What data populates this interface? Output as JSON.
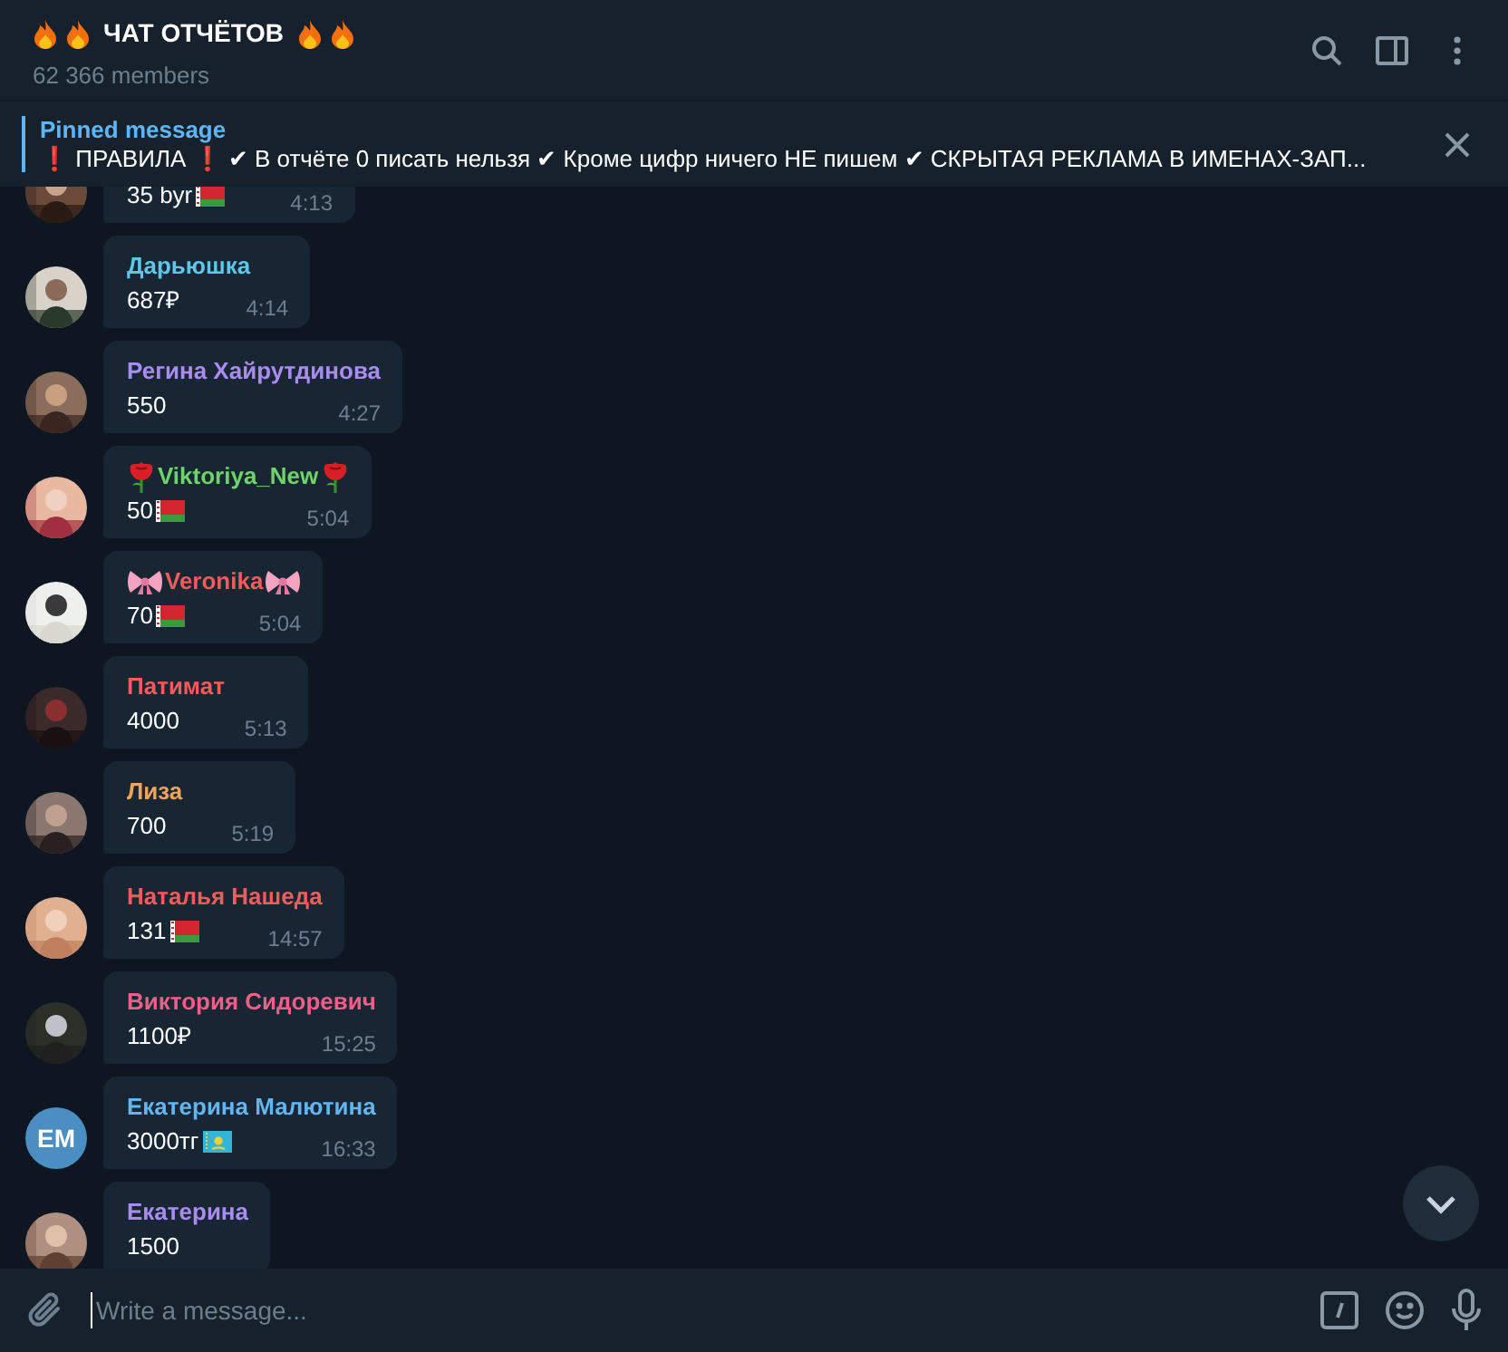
{
  "header": {
    "title": "ЧАТ ОТЧЁТОВ",
    "title_icons_before": [
      {
        "kind": "fire"
      },
      {
        "kind": "fire"
      }
    ],
    "title_icons_after": [
      {
        "kind": "fire"
      },
      {
        "kind": "fire"
      }
    ],
    "subtitle": "62 366 members"
  },
  "pinned": {
    "label": "Pinned message",
    "text": "❗ ПРАВИЛА ❗  ✔ В отчёте 0 писать нельзя ✔ Кроме цифр ничего НЕ пишем ✔ СКРЫТАЯ РЕКЛАМА В ИМЕНАХ-ЗАП..."
  },
  "messages": [
    {
      "body": "35 byr",
      "flag": {
        "kind": "by"
      },
      "time": "4:13"
    },
    {
      "name": "Дарьюшка",
      "color": "#5fc6e8",
      "body": "687₽",
      "time": "4:14"
    },
    {
      "name": "Регина Хайрутдинова",
      "color": "#a98cf0",
      "body": "550",
      "time": "4:27"
    },
    {
      "name": "Viktoriya_New",
      "name_decor": {
        "kind": "rose"
      },
      "color": "#6fd36a",
      "body": "50",
      "flag": {
        "kind": "by"
      },
      "time": "5:04"
    },
    {
      "name": "Veronika",
      "name_decor": {
        "kind": "bow"
      },
      "color": "#ee5c5c",
      "body": "70",
      "flag": {
        "kind": "by"
      },
      "time": "5:04"
    },
    {
      "name": "Патимат",
      "color": "#ee5c5c",
      "body": "4000",
      "time": "5:13"
    },
    {
      "name": "Лиза",
      "color": "#f0a35a",
      "body": "700",
      "time": "5:19"
    },
    {
      "name": "Наталья Нашеда",
      "color": "#ee5c5c",
      "body": "131",
      "flag": {
        "kind": "by"
      },
      "time": "14:57"
    },
    {
      "name": "Виктория Сидоревич",
      "color": "#ec5f88",
      "body": "1100₽",
      "time": "15:25"
    },
    {
      "avatar": {
        "kind": "initials",
        "text": "EM",
        "color": "#4a8ec2"
      },
      "name": "Екатерина Малютина",
      "color": "#62b5ef",
      "body": "3000тг",
      "flag": {
        "kind": "kz"
      },
      "time": "16:33"
    },
    {
      "name": "Екатерина",
      "color": "#a98cf0",
      "body": "1500"
    }
  ],
  "composer": {
    "placeholder": "Write a message..."
  }
}
